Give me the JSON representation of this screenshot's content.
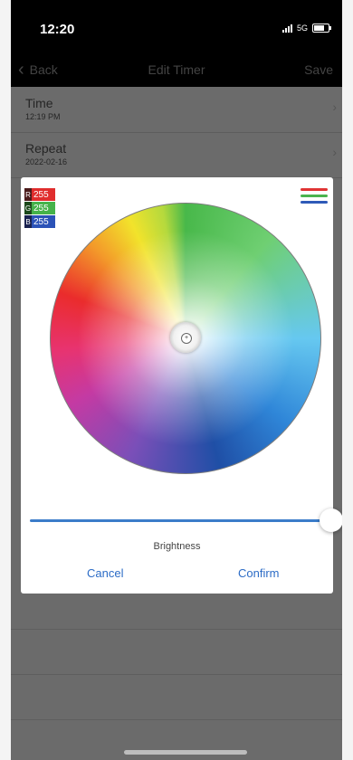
{
  "status_bar": {
    "time": "12:20",
    "network": "5G"
  },
  "nav": {
    "back_label": "Back",
    "title": "Edit Timer",
    "save_label": "Save"
  },
  "rows": [
    {
      "title": "Time",
      "subtitle": "12:19 PM"
    },
    {
      "title": "Repeat",
      "subtitle": "2022-02-16"
    }
  ],
  "color_picker": {
    "rgb": [
      {
        "letter": "R",
        "value": "255"
      },
      {
        "letter": "G",
        "value": "255"
      },
      {
        "letter": "B",
        "value": "255"
      }
    ],
    "palette_colors": [
      "#e03434",
      "#4bb34e",
      "#2e5ab8"
    ],
    "brightness_label": "Brightness",
    "brightness_level": 1.0,
    "cancel_label": "Cancel",
    "confirm_label": "Confirm",
    "accent_color": "#2c6cc6"
  }
}
